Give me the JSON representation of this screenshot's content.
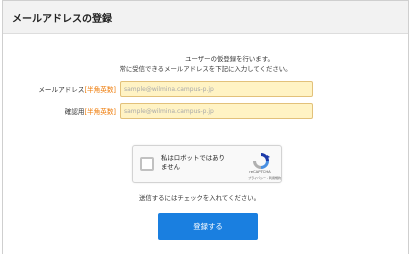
{
  "header": {
    "title": "メールアドレスの登録"
  },
  "intro": {
    "line1": "ユーザーの仮登録を行います。",
    "line2": "常に受信できるメールアドレスを下記に入力してください。"
  },
  "form": {
    "email": {
      "label": "メールアドレス",
      "required_note": "[半角英数]",
      "placeholder": "sample@wilmina.campus-p.jp",
      "value": ""
    },
    "confirm": {
      "label": "確認用",
      "required_note": "[半角英数]",
      "placeholder": "sample@wilmina.campus-p.jp",
      "value": ""
    }
  },
  "recaptcha": {
    "checkbox_label": "私はロボットではありません",
    "brand": "reCAPTCHA",
    "links": "プライバシー - 利用規約",
    "logo_icon": "recaptcha-logo-icon"
  },
  "notice": "送信するにはチェックを入れてください。",
  "submit": {
    "label": "登録する"
  },
  "colors": {
    "accent": "#1a7fe0",
    "required": "#ee7700",
    "input_bg": "#fff3c4",
    "input_border": "#e2c17a"
  }
}
